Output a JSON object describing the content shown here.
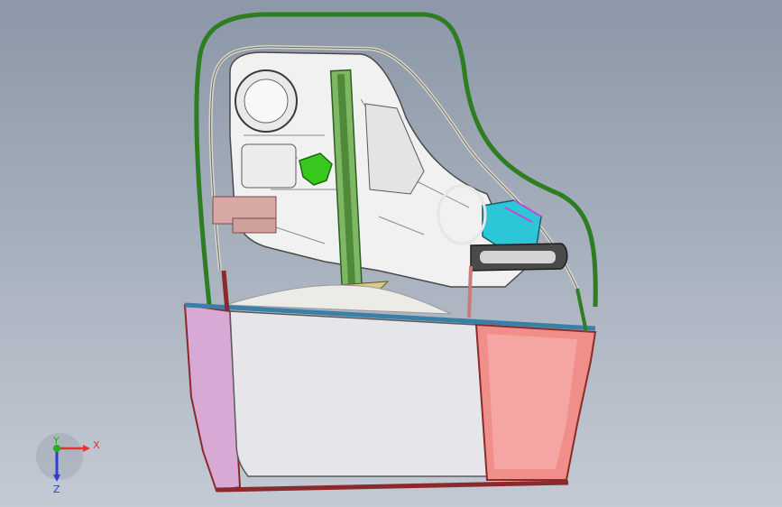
{
  "viewport": {
    "background_top": "#8a96a6",
    "background_bottom": "#c2c9d3"
  },
  "model": {
    "frame_color": "#3a9a2a",
    "inner_panel_color": "#f2f2f2",
    "lower_left_panel_color": "#d9a9d6",
    "lower_right_panel_color": "#f08e8a",
    "glass_color": "#e6e6ea",
    "trim_blue": "#3b7fa6",
    "rail_green": "#6aa84f",
    "accent_cyan": "#2cc6d8",
    "accent_magenta": "#c04ad1",
    "accent_green_part": "#38c81e",
    "hinge_color": "#d8a8a4"
  },
  "triad": {
    "x_label": "X",
    "y_label": "Y",
    "z_label": "Z",
    "x_color": "#e63232",
    "y_color": "#22b022",
    "z_color": "#2c3cd8"
  }
}
